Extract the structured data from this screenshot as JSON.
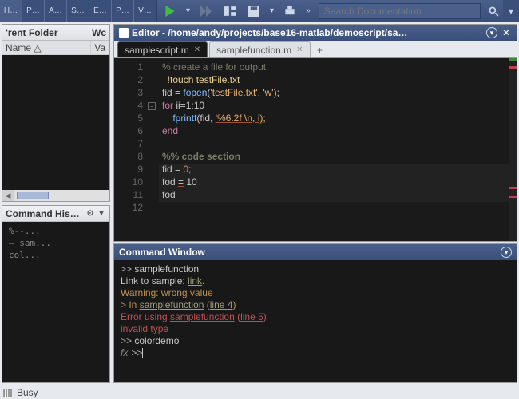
{
  "toolbar": {
    "tabs": [
      "H…",
      "P…",
      "A…",
      "S…",
      "E…",
      "P…",
      "V…"
    ],
    "search_placeholder": "Search Documentation"
  },
  "folder": {
    "title": "'rent Folder",
    "tab": "Wc",
    "columns": {
      "name": "Name △",
      "value": "Va"
    }
  },
  "history": {
    "title": "Command His…",
    "items": [
      {
        "text": "%--...",
        "err": false
      },
      {
        "text": "sam...",
        "err": true
      },
      {
        "text": "col...",
        "err": false
      }
    ]
  },
  "status": {
    "text": "Busy"
  },
  "editor": {
    "title": "Editor - /home/andy/projects/base16-matlab/demoscript/sa…",
    "tabs": [
      {
        "label": "samplescript.m",
        "active": true
      },
      {
        "label": "samplefunction.m",
        "active": false
      }
    ],
    "lines": [
      {
        "n": 1,
        "html": "<span class='c-comment'>% create a file for output</span>"
      },
      {
        "n": 2,
        "html": "  <span class='c-bang'>!touch testFile.txt</span>"
      },
      {
        "n": 3,
        "html": "<span class='c-var'>fid</span> = <span class='c-func'>fopen</span>(<span class='c-str'>'testFile.txt'</span>, <span class='c-str'>'w'</span>);"
      },
      {
        "n": 4,
        "fold": true,
        "html": "<span class='c-key'>for</span> ii=1:10"
      },
      {
        "n": 5,
        "html": "    <span class='c-func'>fprintf</span>(fid, <span class='c-str'>'%6.2f \\n, i);</span>"
      },
      {
        "n": 6,
        "html": "<span class='c-key'>end</span>"
      },
      {
        "n": 7,
        "html": ""
      },
      {
        "n": 8,
        "html": "<span class='c-scomment'>%% code section</span>"
      },
      {
        "n": 9,
        "html": "fid = <span class='c-num'>0</span>;",
        "hl": true
      },
      {
        "n": 10,
        "html": "fod <span class='c-var'>=</span> 10",
        "hl": true
      },
      {
        "n": 11,
        "html": "<span class='c-var'>fod</span>",
        "hl": true
      },
      {
        "n": 12,
        "html": ""
      }
    ]
  },
  "cmd": {
    "title": "Command Window",
    "lines": [
      {
        "html": "<span class='c-prompt'>>> </span>samplefunction"
      },
      {
        "html": "Link to sample: <span class='c-link'>link</span>."
      },
      {
        "html": "<span class='c-warn'>Warning: wrong value</span>"
      },
      {
        "html": "<span class='c-warn'>> In <span class='c-link'>samplefunction</span> (<span class='c-link'>line 4</span>)</span>"
      },
      {
        "html": "<span class='c-err'>Error using <span class='c-link'>samplefunction</span> (<span class='c-link'>line 5</span>)</span>"
      },
      {
        "html": "<span class='c-err'>invalid type</span>"
      },
      {
        "html": "<span class='c-prompt'>>> </span>colordemo"
      }
    ],
    "fx": "fx"
  }
}
